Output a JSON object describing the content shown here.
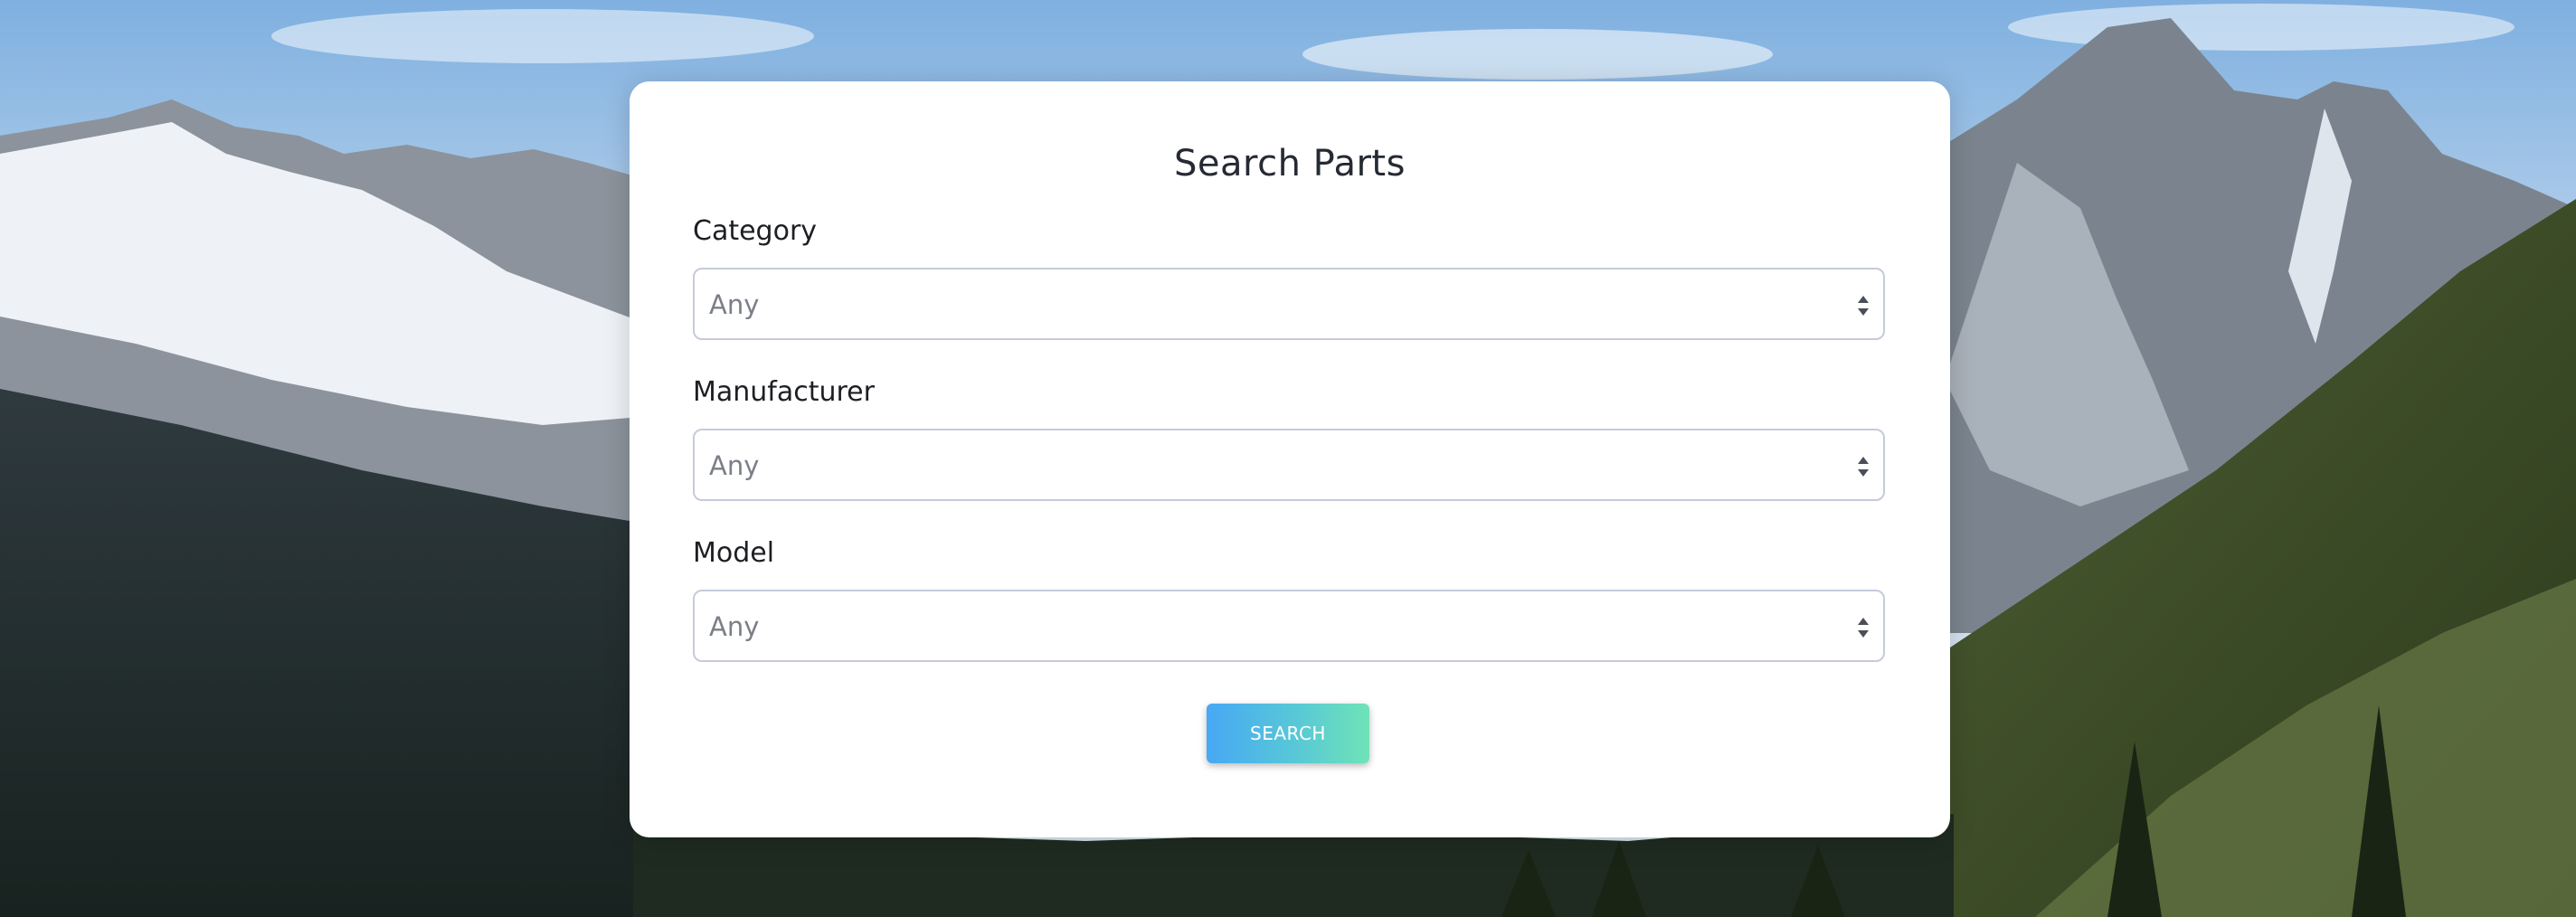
{
  "form": {
    "title": "Search Parts",
    "fields": [
      {
        "label": "Category",
        "value": "Any"
      },
      {
        "label": "Manufacturer",
        "value": "Any"
      },
      {
        "label": "Model",
        "value": "Any"
      }
    ],
    "submit_label": "SEARCH"
  },
  "icons": {
    "select_arrows": "sort-arrows-icon"
  },
  "colors": {
    "button_gradient_start": "#47a8f5",
    "button_gradient_end": "#6fe3b7",
    "card_background": "#ffffff"
  }
}
